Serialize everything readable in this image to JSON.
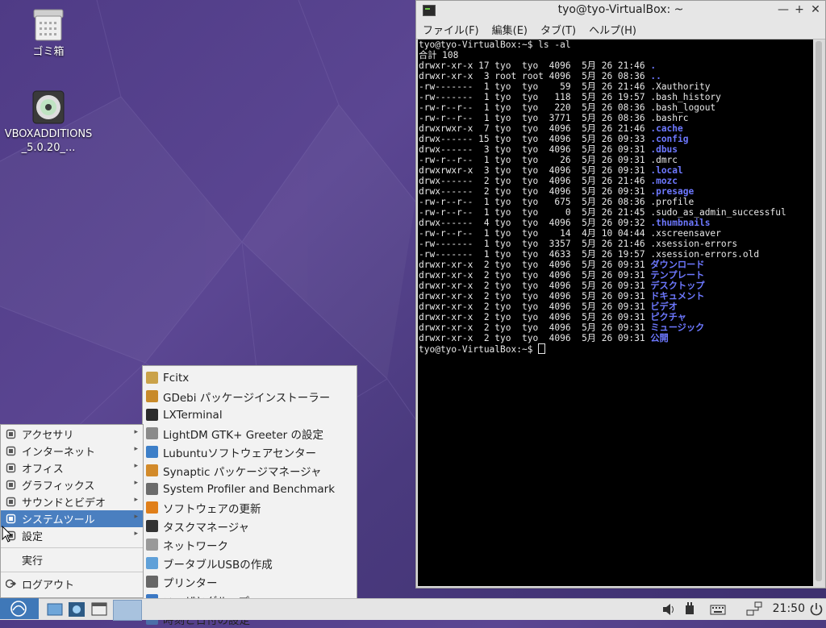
{
  "desktop": {
    "icons": [
      {
        "label": "ゴミ箱",
        "icon": "trash-icon"
      },
      {
        "label": "VBOXADDITIONS_5.0.20_...",
        "icon": "disc-icon"
      }
    ]
  },
  "terminal": {
    "title": "tyo@tyo-VirtualBox: ~",
    "menu": [
      "ファイル(F)",
      "編集(E)",
      "タブ(T)",
      "ヘルプ(H)"
    ],
    "prompt_cmd": "tyo@tyo-VirtualBox:~$ ls -al",
    "total": "合計 108",
    "lines": [
      {
        "meta": "drwxr-xr-x 17 tyo  tyo  4096  5月 26 21:46 ",
        "name": ".",
        "dir": true
      },
      {
        "meta": "drwxr-xr-x  3 root root 4096  5月 26 08:36 ",
        "name": "..",
        "dir": true
      },
      {
        "meta": "-rw-------  1 tyo  tyo    59  5月 26 21:46 ",
        "name": ".Xauthority",
        "dir": false
      },
      {
        "meta": "-rw-------  1 tyo  tyo   118  5月 26 19:57 ",
        "name": ".bash_history",
        "dir": false
      },
      {
        "meta": "-rw-r--r--  1 tyo  tyo   220  5月 26 08:36 ",
        "name": ".bash_logout",
        "dir": false
      },
      {
        "meta": "-rw-r--r--  1 tyo  tyo  3771  5月 26 08:36 ",
        "name": ".bashrc",
        "dir": false
      },
      {
        "meta": "drwxrwxr-x  7 tyo  tyo  4096  5月 26 21:46 ",
        "name": ".cache",
        "dir": true
      },
      {
        "meta": "drwx------ 15 tyo  tyo  4096  5月 26 09:33 ",
        "name": ".config",
        "dir": true
      },
      {
        "meta": "drwx------  3 tyo  tyo  4096  5月 26 09:31 ",
        "name": ".dbus",
        "dir": true
      },
      {
        "meta": "-rw-r--r--  1 tyo  tyo    26  5月 26 09:31 ",
        "name": ".dmrc",
        "dir": false
      },
      {
        "meta": "drwxrwxr-x  3 tyo  tyo  4096  5月 26 09:31 ",
        "name": ".local",
        "dir": true
      },
      {
        "meta": "drwx------  2 tyo  tyo  4096  5月 26 21:46 ",
        "name": ".mozc",
        "dir": true
      },
      {
        "meta": "drwx------  2 tyo  tyo  4096  5月 26 09:31 ",
        "name": ".presage",
        "dir": true
      },
      {
        "meta": "-rw-r--r--  1 tyo  tyo   675  5月 26 08:36 ",
        "name": ".profile",
        "dir": false
      },
      {
        "meta": "-rw-r--r--  1 tyo  tyo     0  5月 26 21:45 ",
        "name": ".sudo_as_admin_successful",
        "dir": false
      },
      {
        "meta": "drwx------  4 tyo  tyo  4096  5月 26 09:32 ",
        "name": ".thumbnails",
        "dir": true
      },
      {
        "meta": "-rw-r--r--  1 tyo  tyo    14  4月 10 04:44 ",
        "name": ".xscreensaver",
        "dir": false
      },
      {
        "meta": "-rw-------  1 tyo  tyo  3357  5月 26 21:46 ",
        "name": ".xsession-errors",
        "dir": false
      },
      {
        "meta": "-rw-------  1 tyo  tyo  4633  5月 26 19:57 ",
        "name": ".xsession-errors.old",
        "dir": false
      },
      {
        "meta": "drwxr-xr-x  2 tyo  tyo  4096  5月 26 09:31 ",
        "name": "ダウンロード",
        "dir": true
      },
      {
        "meta": "drwxr-xr-x  2 tyo  tyo  4096  5月 26 09:31 ",
        "name": "テンプレート",
        "dir": true
      },
      {
        "meta": "drwxr-xr-x  2 tyo  tyo  4096  5月 26 09:31 ",
        "name": "デスクトップ",
        "dir": true
      },
      {
        "meta": "drwxr-xr-x  2 tyo  tyo  4096  5月 26 09:31 ",
        "name": "ドキュメント",
        "dir": true
      },
      {
        "meta": "drwxr-xr-x  2 tyo  tyo  4096  5月 26 09:31 ",
        "name": "ビデオ",
        "dir": true
      },
      {
        "meta": "drwxr-xr-x  2 tyo  tyo  4096  5月 26 09:31 ",
        "name": "ピクチャ",
        "dir": true
      },
      {
        "meta": "drwxr-xr-x  2 tyo  tyo  4096  5月 26 09:31 ",
        "name": "ミュージック",
        "dir": true
      },
      {
        "meta": "drwxr-xr-x  2 tyo  tyo  4096  5月 26 09:31 ",
        "name": "公開",
        "dir": true
      }
    ],
    "final_prompt": "tyo@tyo-VirtualBox:~$ "
  },
  "main_menu": {
    "items": [
      {
        "label": "アクセサリ",
        "icon": "accessories-icon",
        "submenu": true
      },
      {
        "label": "インターネット",
        "icon": "globe-icon",
        "submenu": true
      },
      {
        "label": "オフィス",
        "icon": "office-icon",
        "submenu": true
      },
      {
        "label": "グラフィックス",
        "icon": "graphics-icon",
        "submenu": true
      },
      {
        "label": "サウンドとビデオ",
        "icon": "multimedia-icon",
        "submenu": true
      },
      {
        "label": "システムツール",
        "icon": "monitor-icon",
        "submenu": true,
        "active": true
      },
      {
        "label": "設定",
        "icon": "settings-icon",
        "submenu": true
      }
    ],
    "run": "実行",
    "logout": "ログアウト"
  },
  "system_tools_menu": {
    "items": [
      {
        "label": "Fcitx",
        "icon": "fcitx-icon"
      },
      {
        "label": "GDebi パッケージインストーラー",
        "icon": "package-installer-icon"
      },
      {
        "label": "LXTerminal",
        "icon": "terminal-icon"
      },
      {
        "label": "LightDM GTK+ Greeter の設定",
        "icon": "greeter-settings-icon"
      },
      {
        "label": "Lubuntuソフトウェアセンター",
        "icon": "software-center-icon"
      },
      {
        "label": "Synaptic パッケージマネージャ",
        "icon": "package-manager-icon"
      },
      {
        "label": "System Profiler and Benchmark",
        "icon": "profiler-icon"
      },
      {
        "label": "ソフトウェアの更新",
        "icon": "software-update-icon"
      },
      {
        "label": "タスクマネージャ",
        "icon": "task-manager-icon"
      },
      {
        "label": "ネットワーク",
        "icon": "network-icon"
      },
      {
        "label": "ブータブルUSBの作成",
        "icon": "usb-creator-icon"
      },
      {
        "label": "プリンター",
        "icon": "printer-icon"
      },
      {
        "label": "ユーザとグループ",
        "icon": "users-icon"
      },
      {
        "label": "時刻と日付の設定",
        "icon": "calendar-icon"
      }
    ]
  },
  "panel": {
    "clock": "21:50"
  },
  "colors": {
    "desktop_bg": "#4f3b86",
    "menu_highlight": "#4a7fc0",
    "terminal_dir": "#6d78ff"
  }
}
